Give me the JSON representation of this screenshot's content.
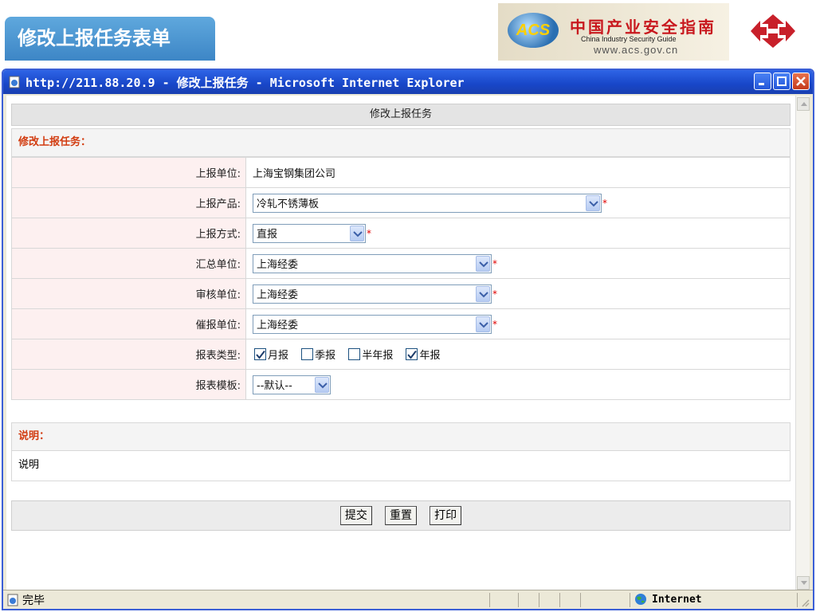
{
  "slide": {
    "title": "修改上报任务表单",
    "banner_cn": "中国产业安全指南",
    "banner_en": "China  Industry  Security  Guide",
    "banner_url": "www.acs.gov.cn",
    "banner_logo_text": "ACS"
  },
  "window": {
    "title": "http://211.88.20.9 - 修改上报任务 - Microsoft Internet Explorer"
  },
  "form": {
    "banner": "修改上报任务",
    "section_title": "修改上报任务：",
    "rows": [
      {
        "label": "上报单位:",
        "value": "上海宝钢集团公司"
      },
      {
        "label": "上报产品:",
        "value": "冷轧不锈薄板"
      },
      {
        "label": "上报方式:",
        "value": "直报"
      },
      {
        "label": "汇总单位:",
        "value": "上海经委"
      },
      {
        "label": "审核单位:",
        "value": "上海经委"
      },
      {
        "label": "催报单位:",
        "value": "上海经委"
      },
      {
        "label": "报表类型:"
      },
      {
        "label": "报表模板:",
        "value": "--默认--"
      }
    ],
    "required_mark": "*",
    "report_types": [
      {
        "label": "月报",
        "checked": true
      },
      {
        "label": "季报",
        "checked": false
      },
      {
        "label": "半年报",
        "checked": false
      },
      {
        "label": "年报",
        "checked": true
      }
    ],
    "notes_title": "说明：",
    "notes_text": "说明",
    "buttons": {
      "submit": "提交",
      "reset": "重置",
      "print": "打印"
    }
  },
  "status": {
    "text": "完毕",
    "zone": "Internet"
  }
}
